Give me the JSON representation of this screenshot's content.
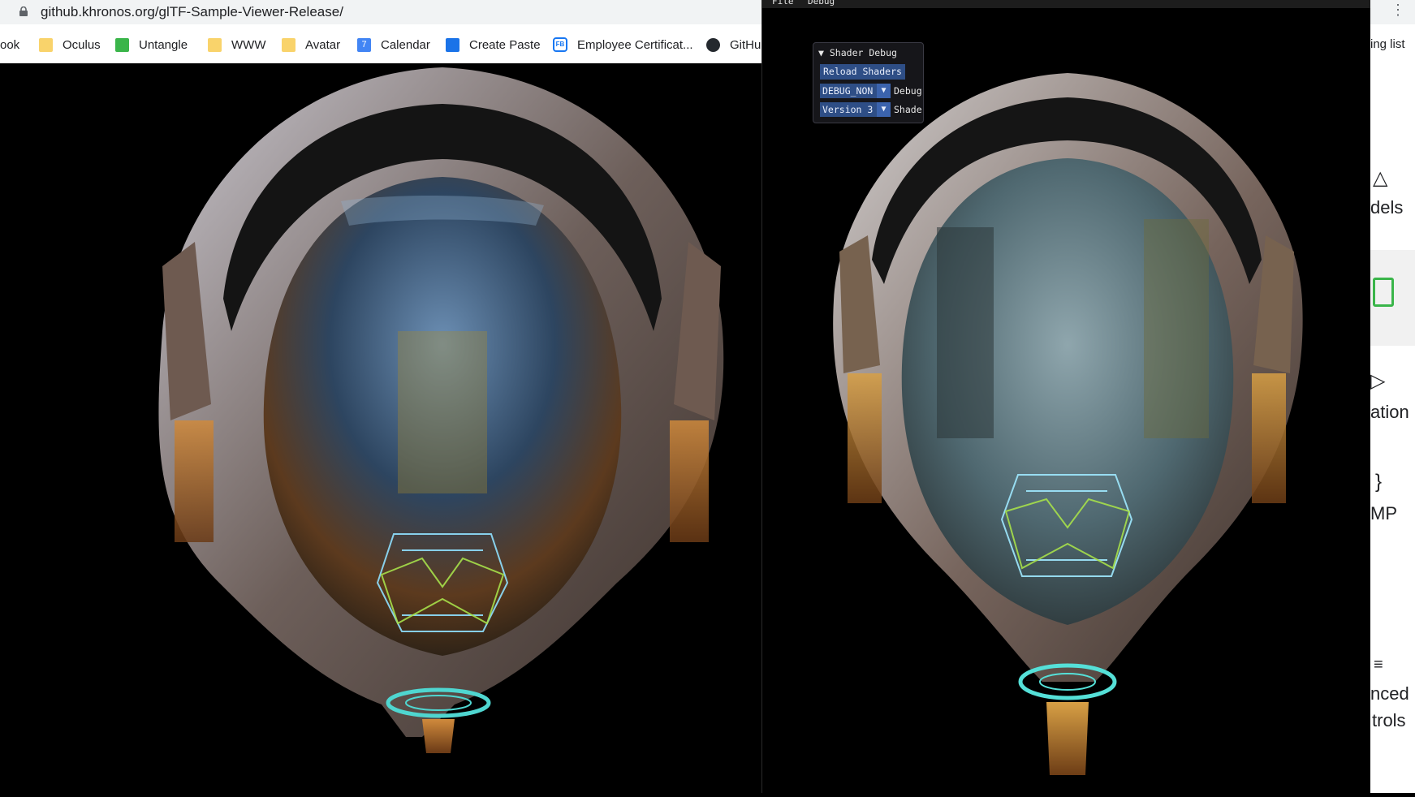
{
  "browser": {
    "url": "github.khronos.org/glTF-Sample-Viewer-Release/",
    "bookmarks": [
      {
        "label": "ook",
        "icon": "none"
      },
      {
        "label": "Oculus",
        "icon": "folder-icon"
      },
      {
        "label": "Untangle",
        "icon": "untangle-icon"
      },
      {
        "label": "WWW",
        "icon": "folder-icon"
      },
      {
        "label": "Avatar",
        "icon": "folder-icon"
      },
      {
        "label": "Calendar",
        "icon": "calendar-icon"
      },
      {
        "label": "Create Paste",
        "icon": "paste-icon"
      },
      {
        "label": "Employee Certificat...",
        "icon": "fb-icon"
      },
      {
        "label": "GitHu",
        "icon": "github-icon"
      }
    ],
    "reading_list": "ing list"
  },
  "viewer": {
    "menu": {
      "file": "File",
      "debug": "Debug"
    },
    "shader_debug": {
      "title": "Shader Debug",
      "reload_button": "Reload Shaders",
      "debug_value": "DEBUG_NONE",
      "debug_label": "Debug",
      "version_value": "Version 3",
      "version_label": "Shader"
    }
  },
  "sidebar": {
    "items": [
      {
        "label": "dels",
        "icon": "cube-icon"
      },
      {
        "label": "",
        "icon": "image-icon"
      },
      {
        "label": "ation",
        "icon": "play-icon"
      },
      {
        "label": "MP",
        "icon": "braces-icon"
      },
      {
        "label": "nced",
        "icon": "sliders-icon"
      },
      {
        "label": "trols",
        "icon": ""
      }
    ]
  },
  "colors": {
    "accent_green": "#3ab54a",
    "imgui_blue": "#2e4e86",
    "background": "#000000"
  }
}
